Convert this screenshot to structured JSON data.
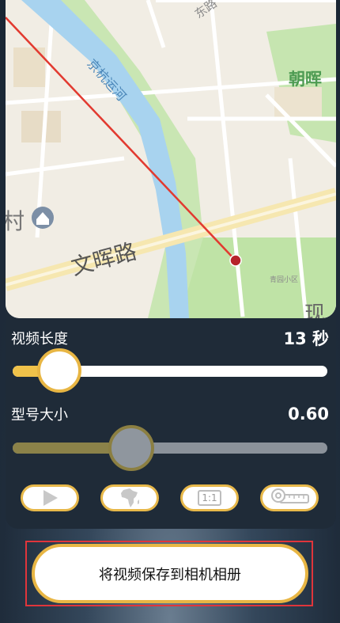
{
  "map": {
    "labels": {
      "road_top": "东路",
      "canal": "京杭运河",
      "district": "朝晖",
      "road_main": "文晖路",
      "partial_left": "村",
      "partial_right": "现",
      "poi1": "青园小区"
    }
  },
  "video_length": {
    "label": "视频长度",
    "value": "13 秒",
    "fraction": 0.17
  },
  "model_size": {
    "label": "型号大小",
    "value": "0.60",
    "fraction": 0.36
  },
  "buttons": [
    {
      "name": "play",
      "icon": "play-icon"
    },
    {
      "name": "africa",
      "icon": "africa-map-icon"
    },
    {
      "name": "ratio",
      "icon": "aspect-ratio-icon",
      "label": "1:1"
    },
    {
      "name": "ruler",
      "icon": "ruler-icon"
    }
  ],
  "save_button": {
    "label": "将视频保存到相机相册"
  },
  "colors": {
    "accent": "#e7b84a",
    "route": "#e23a30",
    "map_green": "#bfe3a6",
    "map_water": "#a8d3ef"
  }
}
